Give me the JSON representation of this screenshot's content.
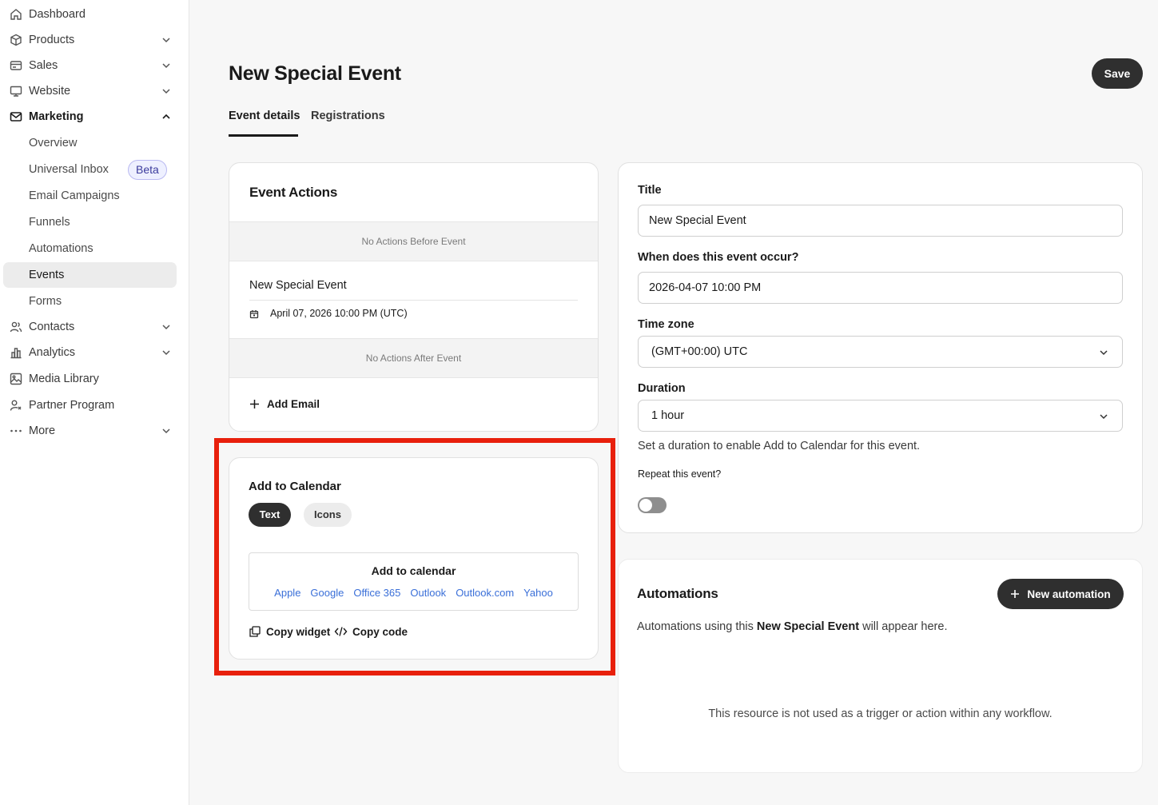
{
  "sidebar": {
    "items": [
      {
        "label": "Dashboard",
        "icon": "home-icon"
      },
      {
        "label": "Products",
        "icon": "box-icon"
      },
      {
        "label": "Sales",
        "icon": "card-icon"
      },
      {
        "label": "Website",
        "icon": "monitor-icon"
      },
      {
        "label": "Marketing",
        "icon": "mail-icon"
      },
      {
        "label": "Contacts",
        "icon": "users-icon"
      },
      {
        "label": "Analytics",
        "icon": "chart-icon"
      },
      {
        "label": "Media Library",
        "icon": "image-icon"
      },
      {
        "label": "Partner Program",
        "icon": "partner-icon"
      },
      {
        "label": "More",
        "icon": "dots-icon"
      }
    ],
    "marketing_sub": [
      {
        "label": "Overview"
      },
      {
        "label": "Universal Inbox"
      },
      {
        "label": "Email Campaigns"
      },
      {
        "label": "Funnels"
      },
      {
        "label": "Automations"
      },
      {
        "label": "Events"
      },
      {
        "label": "Forms"
      }
    ],
    "beta_badge": "Beta"
  },
  "header": {
    "title": "New Special Event",
    "save_label": "Save",
    "tabs": [
      {
        "label": "Event details"
      },
      {
        "label": "Registrations"
      }
    ]
  },
  "event_actions": {
    "heading": "Event Actions",
    "before": "No Actions Before Event",
    "event_name": "New Special Event",
    "event_date": "April 07, 2026 10:00 PM (UTC)",
    "after": "No Actions After Event",
    "add_email": "Add Email"
  },
  "add_to_calendar": {
    "heading": "Add to Calendar",
    "text_tab": "Text",
    "icons_tab": "Icons",
    "preview_title": "Add to calendar",
    "links": [
      "Apple",
      "Google",
      "Office 365",
      "Outlook",
      "Outlook.com",
      "Yahoo"
    ],
    "copy_widget": "Copy widget",
    "copy_code": "Copy code"
  },
  "details": {
    "title_label": "Title",
    "title_value": "New Special Event",
    "when_label": "When does this event occur?",
    "when_value": "2026-04-07 10:00 PM",
    "tz_label": "Time zone",
    "tz_value": "(GMT+00:00) UTC",
    "duration_label": "Duration",
    "duration_value": "1 hour",
    "duration_hint": "Set a duration to enable Add to Calendar for this event.",
    "repeat_label": "Repeat this event?"
  },
  "automations": {
    "heading": "Automations",
    "new_button": "New automation",
    "desc_prefix": "Automations using this ",
    "desc_bold": "New Special Event",
    "desc_suffix": " will appear here.",
    "empty": "This resource is not used as a trigger or action within any workflow."
  },
  "colors": {
    "highlight_border": "#e8200c",
    "link": "#3a6fd8",
    "dark_button": "#2f2f2f"
  }
}
